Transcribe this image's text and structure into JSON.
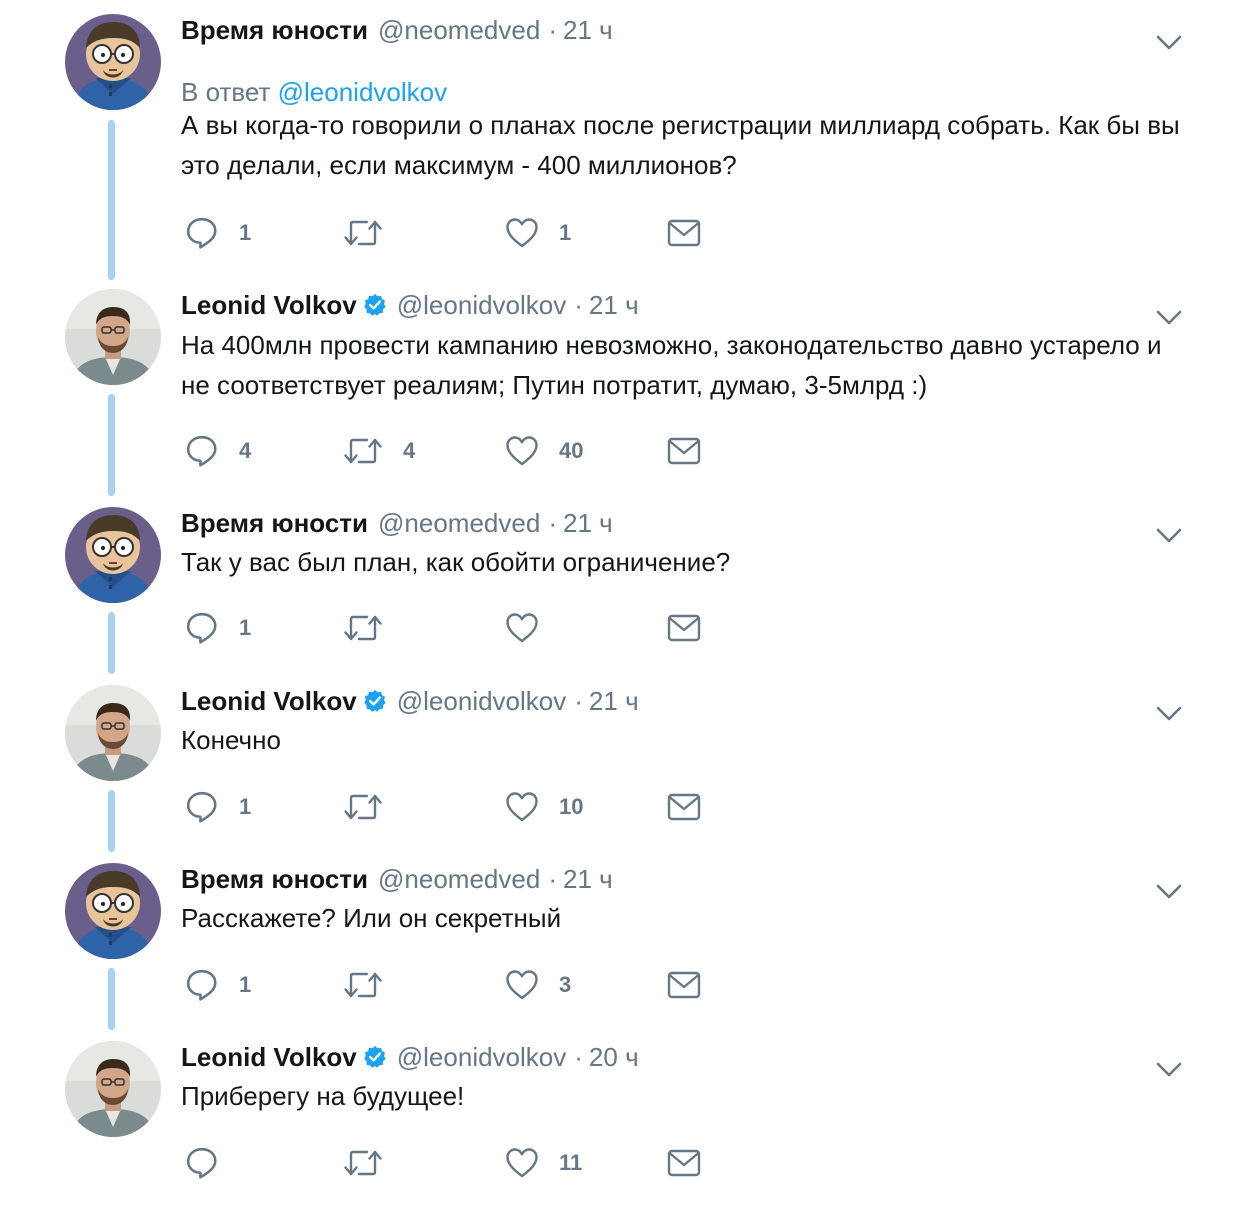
{
  "colors": {
    "link": "#1da1f2",
    "muted": "#657786",
    "thread_line": "#a6d3f2",
    "verified": "#1da1f2"
  },
  "tweets": [
    {
      "name": "Время юности",
      "handle": "@neomedved",
      "time": "21 ч",
      "verified": false,
      "reply_prefix": "В ответ",
      "reply_mention": "@leonidvolkov",
      "text": "А вы когда-то говорили о планах после регистрации миллиард собрать. Как бы вы это делали, если максимум - 400 миллионов?",
      "replies": "1",
      "retweets": "",
      "likes": "1",
      "avatar_icon": "cartoon-avatar-icon"
    },
    {
      "name": "Leonid Volkov",
      "handle": "@leonidvolkov",
      "time": "21 ч",
      "verified": true,
      "text": "На 400млн провести кампанию невозможно, законодательство давно устарело и не соответствует реалиям; Путин потратит, думаю, 3-5млрд :)",
      "replies": "4",
      "retweets": "4",
      "likes": "40",
      "avatar_icon": "photo-avatar-icon"
    },
    {
      "name": "Время юности",
      "handle": "@neomedved",
      "time": "21 ч",
      "verified": false,
      "text": "Так у вас был план, как обойти ограничение?",
      "replies": "1",
      "retweets": "",
      "likes": "",
      "avatar_icon": "cartoon-avatar-icon"
    },
    {
      "name": "Leonid Volkov",
      "handle": "@leonidvolkov",
      "time": "21 ч",
      "verified": true,
      "text": "Конечно",
      "replies": "1",
      "retweets": "",
      "likes": "10",
      "avatar_icon": "photo-avatar-icon"
    },
    {
      "name": "Время юности",
      "handle": "@neomedved",
      "time": "21 ч",
      "verified": false,
      "text": "Расскажете? Или он секретный",
      "replies": "1",
      "retweets": "",
      "likes": "3",
      "avatar_icon": "cartoon-avatar-icon"
    },
    {
      "name": "Leonid Volkov",
      "handle": "@leonidvolkov",
      "time": "20 ч",
      "verified": true,
      "text": "Приберегу на будущее!",
      "replies": "",
      "retweets": "",
      "likes": "11",
      "avatar_icon": "photo-avatar-icon"
    }
  ]
}
